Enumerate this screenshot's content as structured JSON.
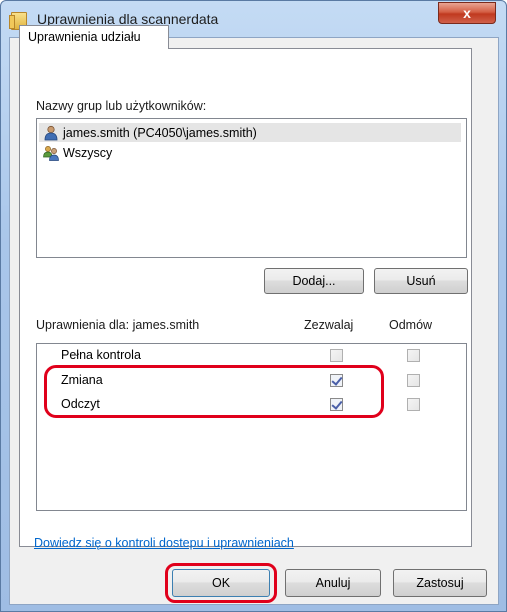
{
  "window": {
    "title": "Uprawnienia dla scannerdata",
    "close_glyph": "x"
  },
  "tabs": [
    {
      "label": "Uprawnienia udziału",
      "selected": true
    }
  ],
  "groups": {
    "label": "Nazwy grup lub użytkowników:",
    "items": [
      {
        "name": "james.smith (PC4050\\james.smith)",
        "icon": "user-icon",
        "selected": true
      },
      {
        "name": "Wszyscy",
        "icon": "users-group-icon",
        "selected": false
      }
    ],
    "add_button": "Dodaj...",
    "remove_button": "Usuń"
  },
  "permissions": {
    "label": "Uprawnienia dla: james.smith",
    "col_allow": "Zezwalaj",
    "col_deny": "Odmów",
    "rows": [
      {
        "name": "Pełna kontrola",
        "allow": false,
        "deny": false
      },
      {
        "name": "Zmiana",
        "allow": true,
        "deny": false
      },
      {
        "name": "Odczyt",
        "allow": true,
        "deny": false
      }
    ]
  },
  "help_link": "Dowiedz się o kontroli dostepu i uprawnieniach",
  "buttons": {
    "ok": "OK",
    "cancel": "Anuluj",
    "apply": "Zastosuj"
  },
  "colors": {
    "highlight": "#e0001b",
    "link": "#0066cc",
    "close": "#c0391f"
  }
}
